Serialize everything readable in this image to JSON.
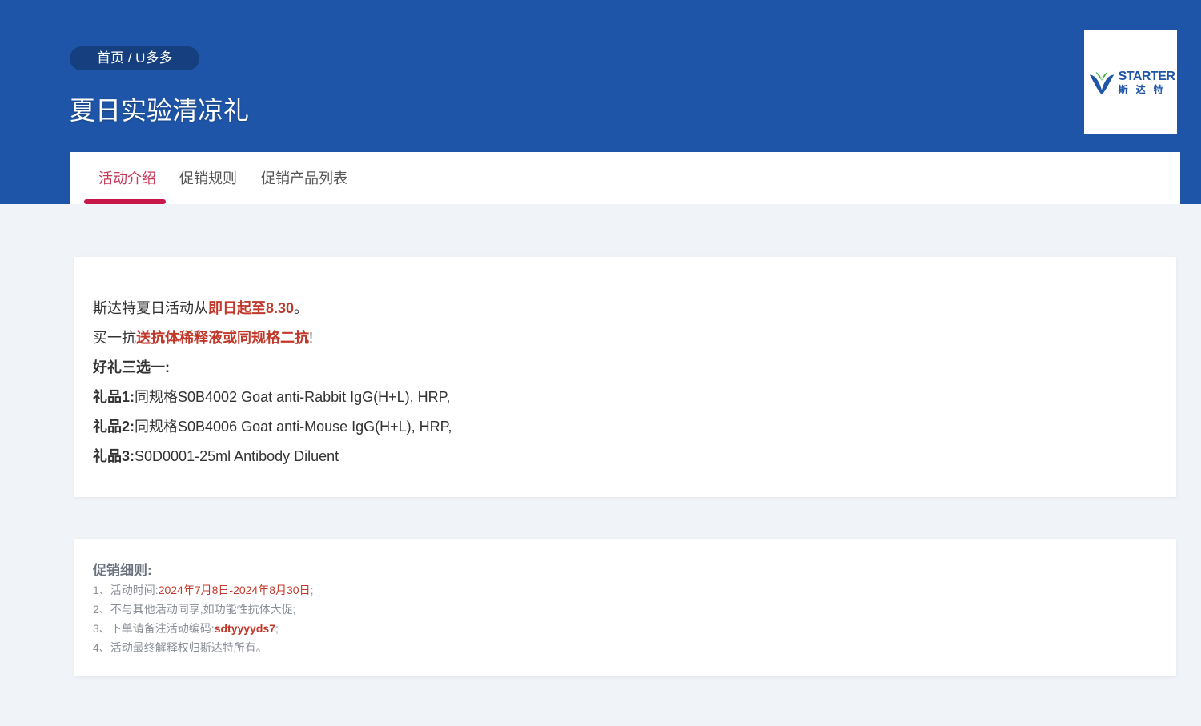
{
  "header": {
    "breadcrumb": "首页 / U多多",
    "title": "夏日实验清凉礼",
    "logo": {
      "en": "STARTER",
      "cn": "斯达特"
    }
  },
  "tabs": [
    {
      "label": "活动介绍",
      "active": true
    },
    {
      "label": "促销规则",
      "active": false
    },
    {
      "label": "促销产品列表",
      "active": false
    }
  ],
  "intro": {
    "line1": {
      "prefix": "斯达特夏日活动从",
      "highlight": "即日起至8.30",
      "suffix": "。"
    },
    "line2": {
      "prefix": "买一抗",
      "highlight": "送抗体稀释液或同规格二抗",
      "suffix": "!"
    },
    "line3": "好礼三选一:",
    "gifts": [
      {
        "label": "礼品1:",
        "text": "同规格S0B4002  Goat anti-Rabbit IgG(H+L), HRP,"
      },
      {
        "label": "礼品2:",
        "text": "同规格S0B4006 Goat anti-Mouse IgG(H+L), HRP,"
      },
      {
        "label": "礼品3:",
        "text": "S0D0001-25ml Antibody Diluent"
      }
    ]
  },
  "rules": {
    "title": "促销细则:",
    "r1": {
      "prefix": "1、活动时间:",
      "value": "2024年7月8日-2024年8月30日",
      "suffix": ";"
    },
    "r2": "2、不与其他活动同享,如功能性抗体大促;",
    "r3": {
      "prefix": "3、下单请备注活动编码:",
      "value": "sdtyyyyds7",
      "suffix": ";"
    },
    "r4": "4、活动最终解释权归斯达特所有。"
  },
  "colors": {
    "hero": "#1f55a8",
    "accent": "#c8184a",
    "highlight": "#c0392b"
  }
}
